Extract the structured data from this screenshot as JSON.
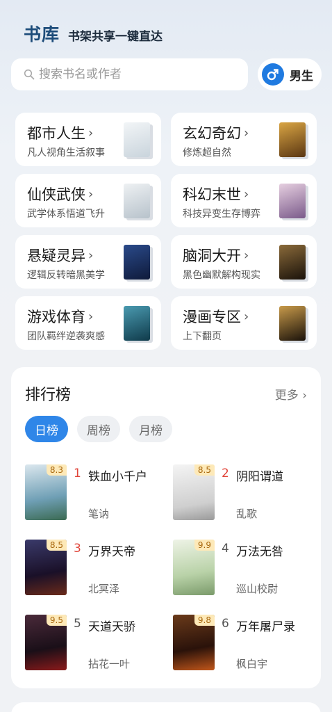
{
  "header": {
    "title": "书库",
    "subtitle": "书架共享一键直达"
  },
  "search": {
    "placeholder": "搜索书名或作者",
    "value": ""
  },
  "gender": {
    "label": "男生",
    "icon": "male-icon",
    "color": "#1f7ae0"
  },
  "categories": [
    {
      "name": "都市人生",
      "desc": "凡人视角生活叙事",
      "cover_color": "#e8edf1"
    },
    {
      "name": "玄幻奇幻",
      "desc": "修炼超自然",
      "cover_color": "#6b4a1c"
    },
    {
      "name": "仙侠武侠",
      "desc": "武学体系悟道飞升",
      "cover_color": "#dfe5ea"
    },
    {
      "name": "科幻末世",
      "desc": "科技异变生存博弈",
      "cover_color": "#c8a9c8"
    },
    {
      "name": "悬疑灵异",
      "desc": "逻辑反转暗黑美学",
      "cover_color": "#1a2c5a"
    },
    {
      "name": "脑洞大开",
      "desc": "黑色幽默解构现实",
      "cover_color": "#3a2a18"
    },
    {
      "name": "游戏体育",
      "desc": "团队羁绊逆袭爽感",
      "cover_color": "#1f5f7a"
    },
    {
      "name": "漫画专区",
      "desc": "上下翻页",
      "cover_color": "#2a2118"
    }
  ],
  "ranking": {
    "title": "排行榜",
    "more": "更多",
    "tabs": [
      "日榜",
      "周榜",
      "月榜"
    ],
    "active_tab": "日榜",
    "books": [
      {
        "rank": "1",
        "name": "铁血小千户",
        "author": "笔讷",
        "score": "8.3",
        "cover_color": "#a9c7d6",
        "rank_color": "#e0453a"
      },
      {
        "rank": "2",
        "name": "阴阳谓道",
        "author": "乱歌",
        "score": "8.5",
        "cover_color": "#e6e6e6",
        "rank_color": "#e0453a"
      },
      {
        "rank": "3",
        "name": "万界天帝",
        "author": "北冥泽",
        "score": "8.5",
        "cover_color": "#2a1f3a",
        "rank_color": "#e0453a"
      },
      {
        "rank": "4",
        "name": "万法无咎",
        "author": "巡山校尉",
        "score": "9.9",
        "cover_color": "#cfe0c2",
        "rank_color": "#555555"
      },
      {
        "rank": "5",
        "name": "天道天骄",
        "author": "拈花一叶",
        "score": "9.5",
        "cover_color": "#2a1a22",
        "rank_color": "#555555"
      },
      {
        "rank": "6",
        "name": "万年屠尸录",
        "author": "枫白宇",
        "score": "9.8",
        "cover_color": "#3a1a12",
        "rank_color": "#555555"
      }
    ]
  }
}
